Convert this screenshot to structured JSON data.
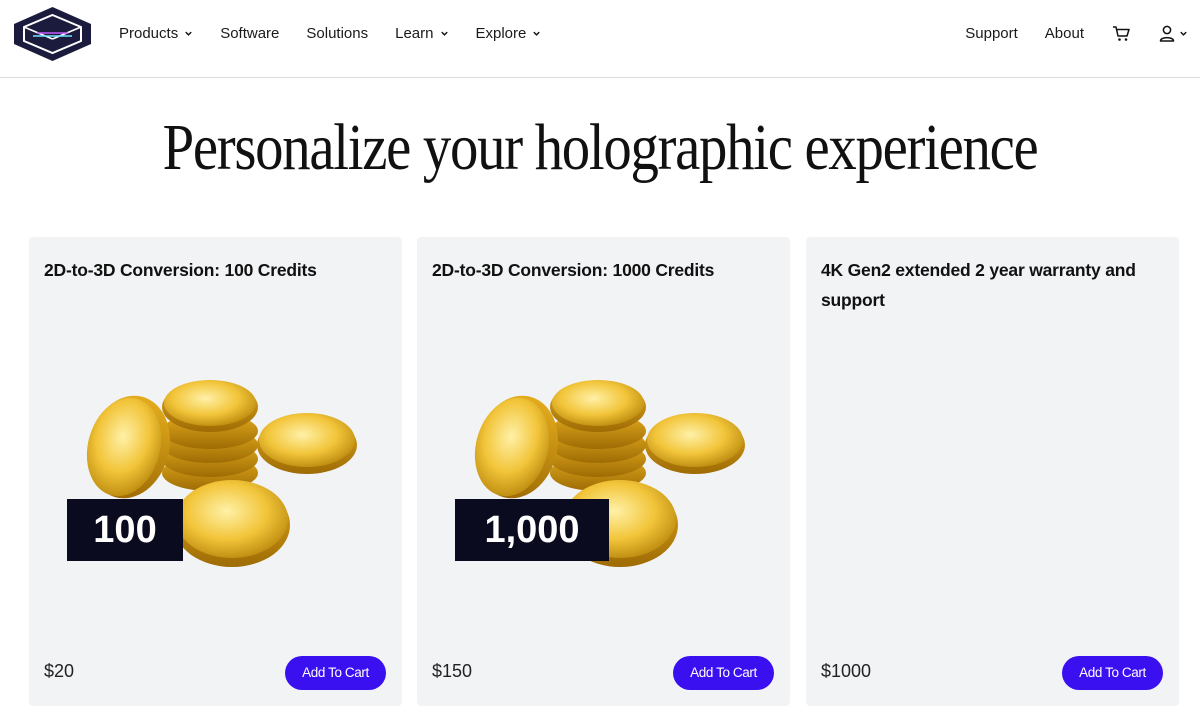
{
  "nav": {
    "left_items": [
      {
        "label": "Products",
        "has_dropdown": true
      },
      {
        "label": "Software",
        "has_dropdown": false
      },
      {
        "label": "Solutions",
        "has_dropdown": false
      },
      {
        "label": "Learn",
        "has_dropdown": true
      },
      {
        "label": "Explore",
        "has_dropdown": true
      }
    ],
    "right_items": [
      {
        "label": "Support"
      },
      {
        "label": "About"
      }
    ],
    "icons": {
      "cart": "cart-icon",
      "account": "user-icon",
      "logo": "hologram-cube-logo"
    }
  },
  "hero": {
    "title": "Personalize your holographic experience"
  },
  "products": [
    {
      "title": "2D-to-3D Conversion: 100 Credits",
      "badge": "100",
      "price": "$20",
      "button": "Add To Cart"
    },
    {
      "title": "2D-to-3D Conversion: 1000 Credits",
      "badge": "1,000",
      "price": "$150",
      "button": "Add To Cart"
    },
    {
      "title": "4K Gen2 extended 2 year warranty and support",
      "badge": "",
      "price": "$1000",
      "button": "Add To Cart"
    }
  ],
  "colors": {
    "accent": "#3a0ff0",
    "card_bg": "#f2f3f5",
    "badge_bg": "#0b0b1f",
    "coin_gold": "#e8b923"
  }
}
